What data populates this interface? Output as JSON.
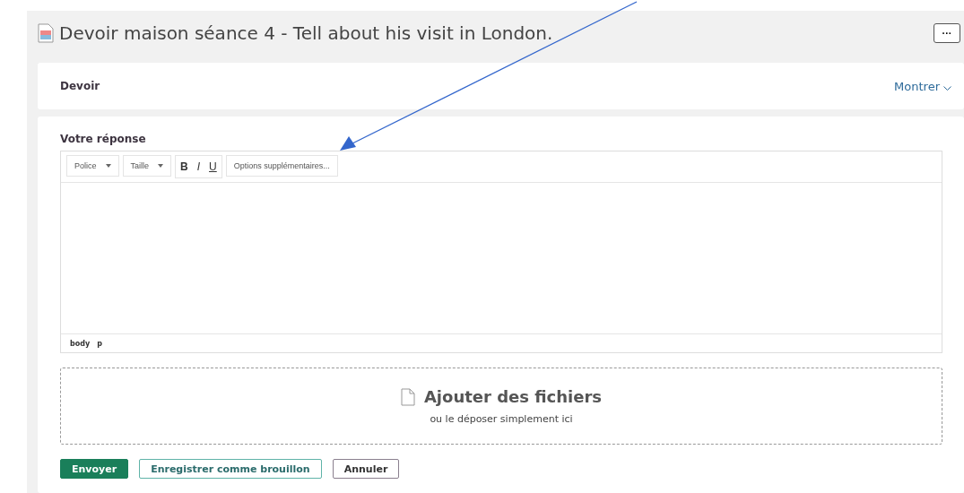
{
  "title": "Devoir maison séance 4 - Tell about his visit in London.",
  "more_button": "···",
  "assignment": {
    "label": "Devoir",
    "toggle": "Montrer"
  },
  "response": {
    "label": "Votre réponse",
    "toolbar": [
      {
        "kind": "dropdown",
        "label": "Police"
      },
      {
        "kind": "dropdown",
        "label": "Taille"
      },
      {
        "kind": "bold",
        "label": "B"
      },
      {
        "kind": "italic",
        "label": "I"
      },
      {
        "kind": "underline",
        "label": "U"
      },
      {
        "kind": "button",
        "label": "Options supplémentaires..."
      }
    ],
    "path": [
      "body",
      "p"
    ]
  },
  "upload": {
    "title": "Ajouter des fichiers",
    "hint": "ou le déposer simplement ici"
  },
  "actions": [
    {
      "label": "Envoyer",
      "kind": "primary"
    },
    {
      "label": "Enregistrer comme brouillon",
      "kind": "secondary"
    },
    {
      "label": "Annuler",
      "kind": "plain"
    }
  ]
}
